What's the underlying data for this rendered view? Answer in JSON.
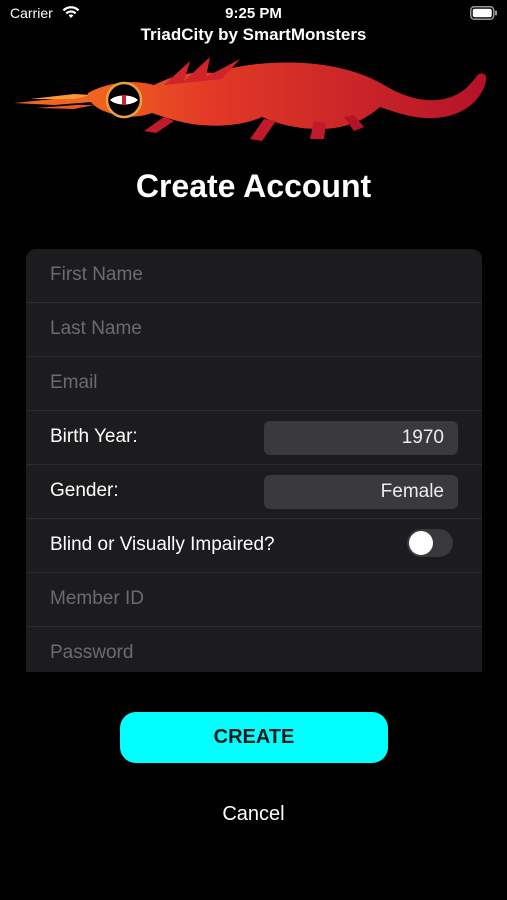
{
  "status_bar": {
    "carrier": "Carrier",
    "time": "9:25 PM",
    "wifi_icon": "wifi-icon",
    "battery_icon": "battery-full-icon"
  },
  "header": {
    "app_title": "TriadCity by SmartMonsters",
    "logo_icon": "dragon-logo"
  },
  "page_title": "Create Account",
  "form": {
    "first_name": {
      "placeholder": "First Name",
      "value": ""
    },
    "last_name": {
      "placeholder": "Last Name",
      "value": ""
    },
    "email": {
      "placeholder": "Email",
      "value": ""
    },
    "birth_year": {
      "label": "Birth Year:",
      "value": "1970"
    },
    "gender": {
      "label": "Gender:",
      "value": "Female"
    },
    "blind": {
      "label": "Blind or Visually Impaired?",
      "enabled": false
    },
    "member_id": {
      "placeholder": "Member ID",
      "value": ""
    },
    "password": {
      "placeholder": "Password",
      "value": ""
    }
  },
  "actions": {
    "create_label": "CREATE",
    "cancel_label": "Cancel"
  },
  "colors": {
    "background": "#000000",
    "card": "#1c1c1e",
    "accent_button": "#00ffff",
    "dragon_red": "#d2232a",
    "dragon_orange": "#f2661f",
    "eye_ring": "#e8a33a"
  }
}
